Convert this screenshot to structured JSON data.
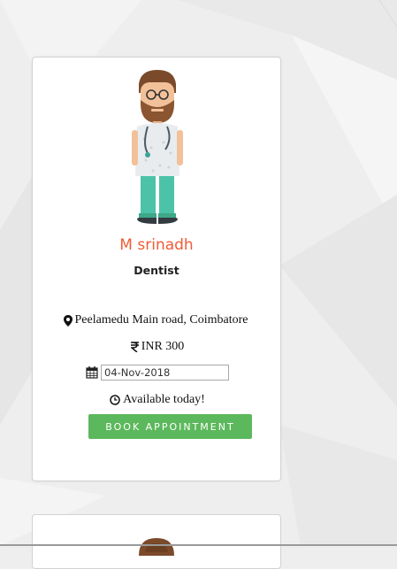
{
  "doctor": {
    "name": "M srinadh",
    "specialty": "Dentist",
    "location": "Peelamedu Main road, Coimbatore",
    "fee": "INR 300",
    "date_value": "04-Nov-2018",
    "availability": "Available today!",
    "book_label": "BOOK APPOINTMENT"
  },
  "icons": {
    "location": "map-marker-icon",
    "currency": "rupee-icon",
    "calendar": "calendar-icon",
    "clock": "clock-icon"
  },
  "colors": {
    "name": "#ef5c36",
    "button": "#5cb85c",
    "background": "#eeeeef"
  }
}
